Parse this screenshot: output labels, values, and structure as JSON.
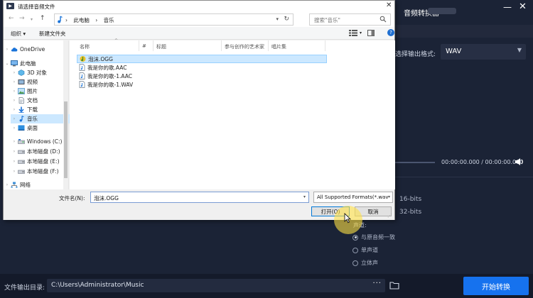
{
  "app": {
    "title": "音频转换器",
    "format_label": "选择输出格式:",
    "format_value": "WAV",
    "time_display": "00:00:00.000  /  00:00:00.000",
    "bits_16": "16-bits",
    "bits_32": "32-bits",
    "channel_label": "声道:",
    "channel_options": [
      "与原音频一致",
      "单声道",
      "立体声"
    ],
    "output_label": "文件输出目录:",
    "output_path": "C:\\Users\\Administrator\\Music",
    "output_more": "···",
    "convert_label": "开始转换"
  },
  "dialog": {
    "title": "请选择音频文件",
    "address": [
      "此电脑",
      "音乐"
    ],
    "search_placeholder": "搜索\"音乐\"",
    "organize": "组织 ▾",
    "new_folder": "新建文件夹",
    "tree": [
      {
        "label": "OneDrive",
        "icon": "cloud-icon"
      },
      {
        "label": "此电脑",
        "icon": "computer-icon"
      },
      {
        "label": "3D 对象",
        "icon": "cube-icon"
      },
      {
        "label": "视频",
        "icon": "video-icon"
      },
      {
        "label": "图片",
        "icon": "picture-icon"
      },
      {
        "label": "文档",
        "icon": "document-icon"
      },
      {
        "label": "下载",
        "icon": "download-icon"
      },
      {
        "label": "音乐",
        "icon": "music-icon"
      },
      {
        "label": "桌面",
        "icon": "desktop-icon"
      },
      {
        "label": "Windows (C:)",
        "icon": "drive-icon"
      },
      {
        "label": "本地磁盘 (D:)",
        "icon": "drive-icon"
      },
      {
        "label": "本地磁盘 (E:)",
        "icon": "drive-icon"
      },
      {
        "label": "本地磁盘 (F:)",
        "icon": "drive-icon"
      },
      {
        "label": "网络",
        "icon": "network-icon"
      }
    ],
    "columns": [
      "名称",
      "#",
      "标题",
      "参与创作的艺术家",
      "唱片集"
    ],
    "files": [
      {
        "name": "泡沫.OGG",
        "icon": "ogg-file-icon",
        "selected": true
      },
      {
        "name": "我是你的歌.AAC",
        "icon": "audio-file-icon",
        "selected": false
      },
      {
        "name": "我是你的歌-1.AAC",
        "icon": "audio-file-icon",
        "selected": false
      },
      {
        "name": "我是你的歌-1.WAV",
        "icon": "audio-file-icon",
        "selected": false
      }
    ],
    "filename_label": "文件名(N):",
    "filename_value": "泡沫.OGG",
    "filetype_value": "All Supported Formats(*.wav",
    "open_label": "打开(O)",
    "cancel_label": "取消"
  },
  "colors": {
    "app_bg": "#1b2336",
    "accent": "#1672ee",
    "selection": "#cce8ff",
    "cursor_highlight": "#ffe146"
  }
}
